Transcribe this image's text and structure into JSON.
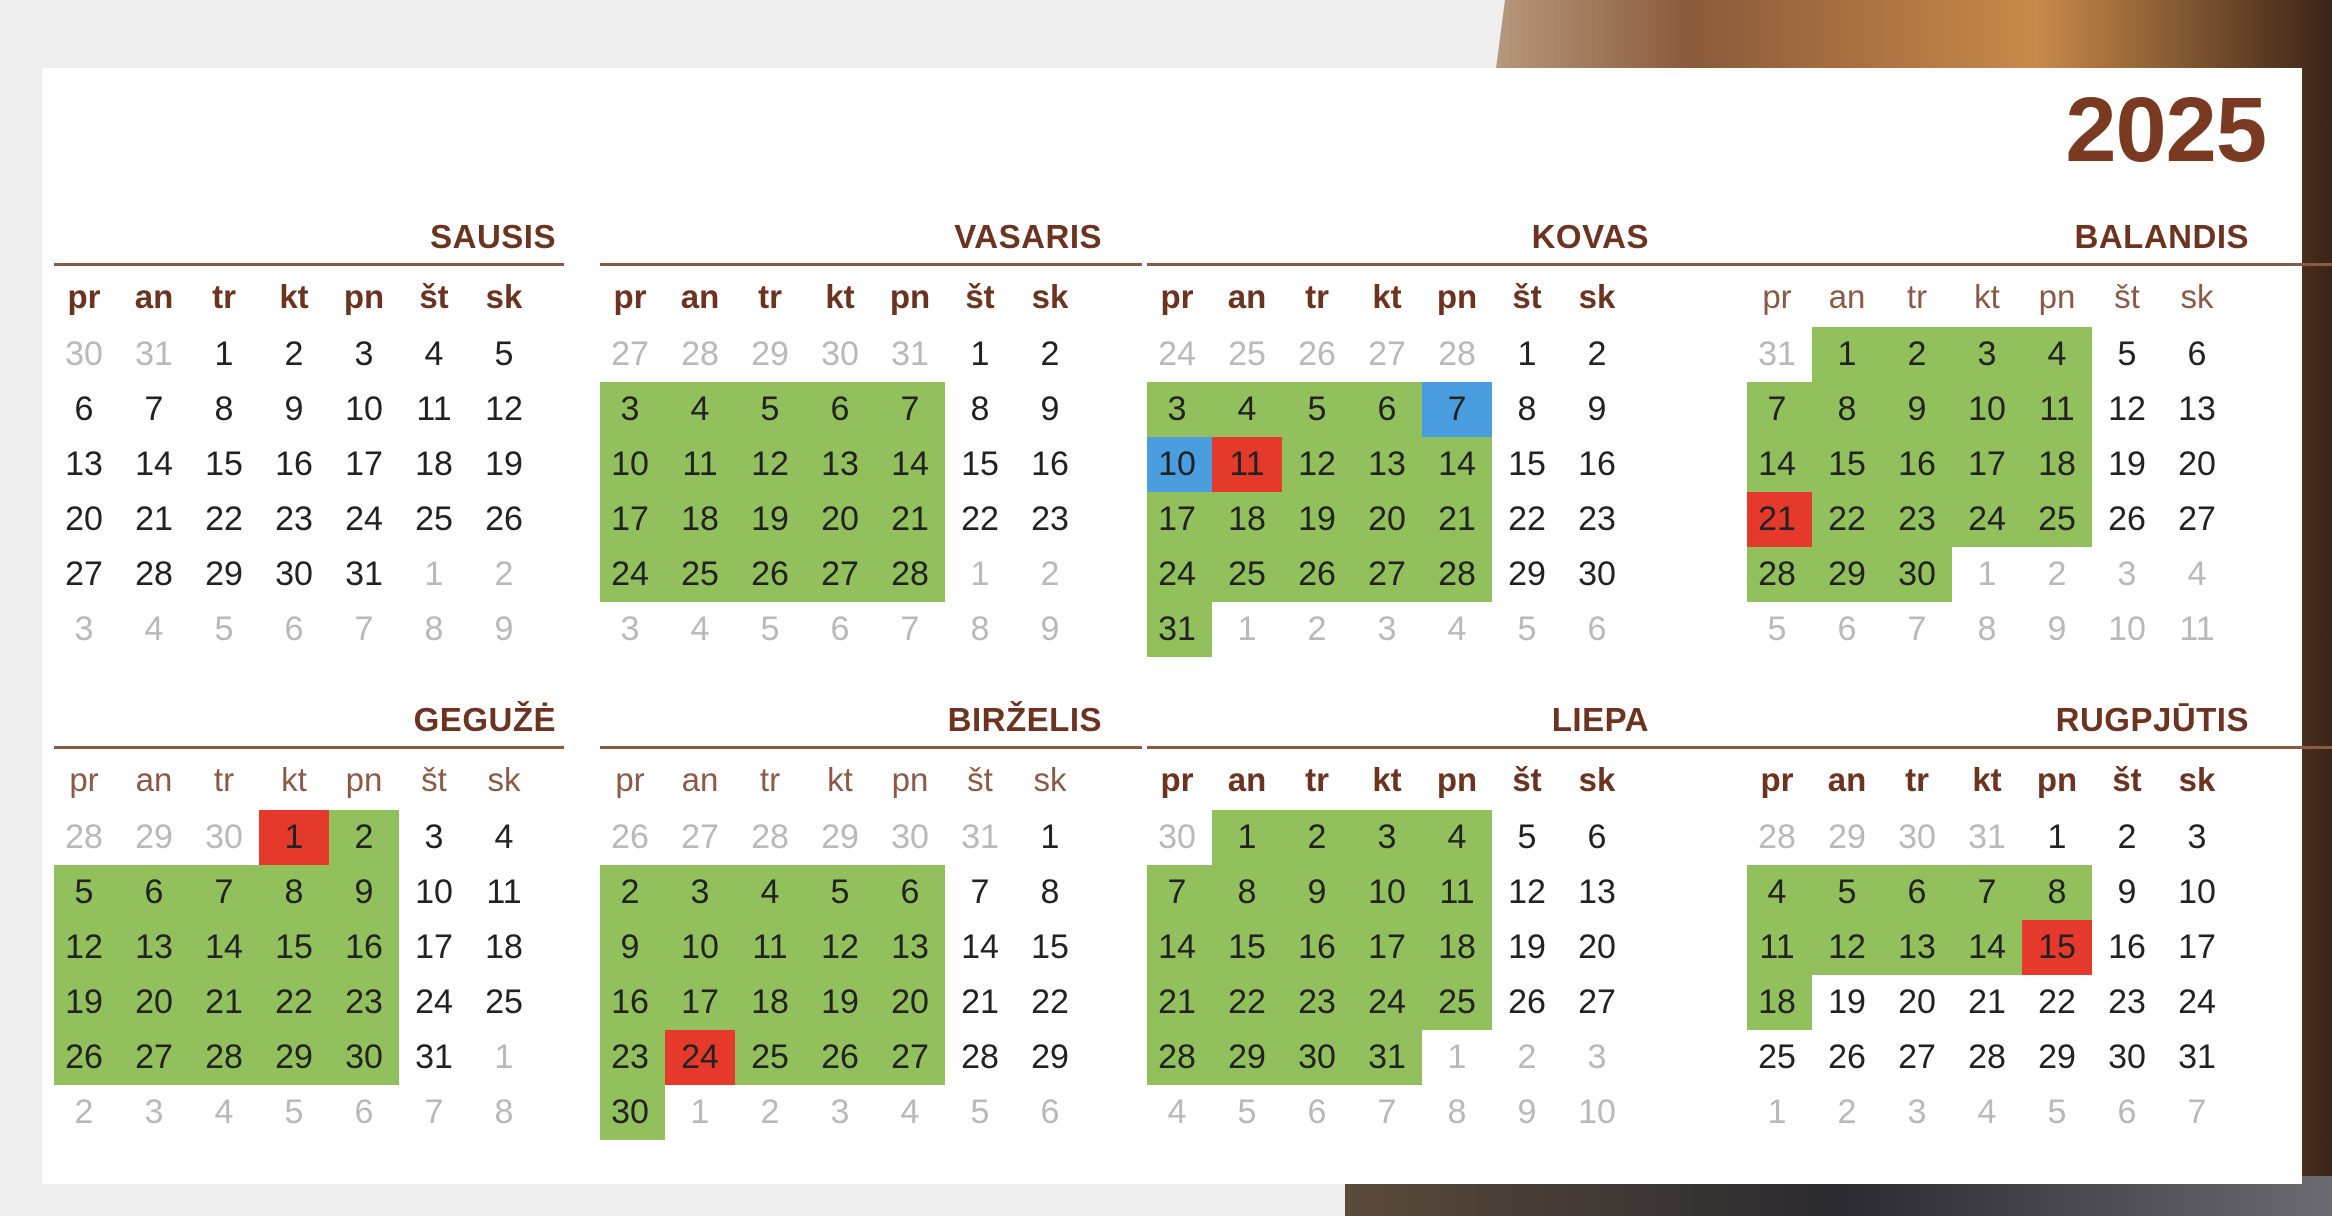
{
  "year": "2025",
  "colors": {
    "workday": "#92c05c",
    "holiday": "#e53a2b",
    "special": "#4a9ee0",
    "title": "#6b3320",
    "muted": "#b9b9b9"
  },
  "day_headers": [
    "pr",
    "an",
    "tr",
    "kt",
    "pn",
    "št",
    "sk"
  ],
  "months": [
    {
      "name": "SAUSIS",
      "bold_headers": true,
      "weeks": [
        [
          30,
          31,
          1,
          2,
          3,
          4,
          5
        ],
        [
          6,
          7,
          8,
          9,
          10,
          11,
          12
        ],
        [
          13,
          14,
          15,
          16,
          17,
          18,
          19
        ],
        [
          20,
          21,
          22,
          23,
          24,
          25,
          26
        ],
        [
          27,
          28,
          29,
          30,
          31,
          1,
          2
        ],
        [
          3,
          4,
          5,
          6,
          7,
          8,
          9
        ]
      ],
      "marks": []
    },
    {
      "name": "VASARIS",
      "bold_headers": true,
      "weeks": [
        [
          27,
          28,
          29,
          30,
          31,
          1,
          2
        ],
        [
          3,
          4,
          5,
          6,
          7,
          8,
          9
        ],
        [
          10,
          11,
          12,
          13,
          14,
          15,
          16
        ],
        [
          17,
          18,
          19,
          20,
          21,
          22,
          23
        ],
        [
          24,
          25,
          26,
          27,
          28,
          1,
          2
        ],
        [
          3,
          4,
          5,
          6,
          7,
          8,
          9
        ]
      ],
      "marks": [
        [
          1,
          -1,
          4,
          "green"
        ],
        [
          2,
          -1,
          4,
          "green"
        ],
        [
          3,
          -1,
          4,
          "green"
        ],
        [
          4,
          -1,
          4,
          "green"
        ]
      ]
    },
    {
      "name": "KOVAS",
      "bold_headers": true,
      "weeks": [
        [
          24,
          25,
          26,
          27,
          28,
          1,
          2
        ],
        [
          3,
          4,
          5,
          6,
          7,
          8,
          9
        ],
        [
          10,
          11,
          12,
          13,
          14,
          15,
          16
        ],
        [
          17,
          18,
          19,
          20,
          21,
          22,
          23
        ],
        [
          24,
          25,
          26,
          27,
          28,
          29,
          30
        ],
        [
          31,
          1,
          2,
          3,
          4,
          5,
          6
        ]
      ],
      "marks": [
        [
          1,
          -1,
          3,
          "green"
        ],
        [
          1,
          4,
          4,
          "blue"
        ],
        [
          2,
          -1,
          0,
          "blue"
        ],
        [
          2,
          1,
          1,
          "red"
        ],
        [
          2,
          2,
          4,
          "green"
        ],
        [
          3,
          -1,
          4,
          "green"
        ],
        [
          4,
          -1,
          4,
          "green"
        ],
        [
          5,
          -1,
          0,
          "green"
        ]
      ]
    },
    {
      "name": "BALANDIS",
      "bold_headers": false,
      "weeks": [
        [
          31,
          1,
          2,
          3,
          4,
          5,
          6
        ],
        [
          7,
          8,
          9,
          10,
          11,
          12,
          13
        ],
        [
          14,
          15,
          16,
          17,
          18,
          19,
          20
        ],
        [
          21,
          22,
          23,
          24,
          25,
          26,
          27
        ],
        [
          28,
          29,
          30,
          1,
          2,
          3,
          4
        ],
        [
          5,
          6,
          7,
          8,
          9,
          10,
          11
        ]
      ],
      "marks": [
        [
          0,
          1,
          4,
          "green"
        ],
        [
          1,
          -1,
          4,
          "green"
        ],
        [
          2,
          -1,
          4,
          "green"
        ],
        [
          3,
          -1,
          0,
          "red"
        ],
        [
          3,
          1,
          4,
          "green"
        ],
        [
          4,
          -1,
          2,
          "green"
        ]
      ]
    },
    {
      "name": "GEGUŽĖ",
      "bold_headers": false,
      "weeks": [
        [
          28,
          29,
          30,
          1,
          2,
          3,
          4
        ],
        [
          5,
          6,
          7,
          8,
          9,
          10,
          11
        ],
        [
          12,
          13,
          14,
          15,
          16,
          17,
          18
        ],
        [
          19,
          20,
          21,
          22,
          23,
          24,
          25
        ],
        [
          26,
          27,
          28,
          29,
          30,
          31,
          1
        ],
        [
          2,
          3,
          4,
          5,
          6,
          7,
          8
        ]
      ],
      "marks": [
        [
          0,
          3,
          3,
          "red"
        ],
        [
          0,
          4,
          4,
          "green"
        ],
        [
          1,
          -1,
          4,
          "green"
        ],
        [
          2,
          -1,
          4,
          "green"
        ],
        [
          3,
          -1,
          4,
          "green"
        ],
        [
          4,
          -1,
          4,
          "green"
        ]
      ]
    },
    {
      "name": "BIRŽELIS",
      "bold_headers": false,
      "weeks": [
        [
          26,
          27,
          28,
          29,
          30,
          31,
          1
        ],
        [
          2,
          3,
          4,
          5,
          6,
          7,
          8
        ],
        [
          9,
          10,
          11,
          12,
          13,
          14,
          15
        ],
        [
          16,
          17,
          18,
          19,
          20,
          21,
          22
        ],
        [
          23,
          24,
          25,
          26,
          27,
          28,
          29
        ],
        [
          30,
          1,
          2,
          3,
          4,
          5,
          6
        ]
      ],
      "marks": [
        [
          1,
          -1,
          4,
          "green"
        ],
        [
          2,
          -1,
          4,
          "green"
        ],
        [
          3,
          -1,
          4,
          "green"
        ],
        [
          4,
          -1,
          0,
          "green"
        ],
        [
          4,
          1,
          1,
          "red"
        ],
        [
          4,
          2,
          4,
          "green"
        ],
        [
          5,
          -1,
          0,
          "green"
        ]
      ]
    },
    {
      "name": "LIEPA",
      "bold_headers": true,
      "weeks": [
        [
          30,
          1,
          2,
          3,
          4,
          5,
          6
        ],
        [
          7,
          8,
          9,
          10,
          11,
          12,
          13
        ],
        [
          14,
          15,
          16,
          17,
          18,
          19,
          20
        ],
        [
          21,
          22,
          23,
          24,
          25,
          26,
          27
        ],
        [
          28,
          29,
          30,
          31,
          1,
          2,
          3
        ],
        [
          4,
          5,
          6,
          7,
          8,
          9,
          10
        ]
      ],
      "marks": [
        [
          0,
          1,
          4,
          "green"
        ],
        [
          1,
          -1,
          4,
          "green"
        ],
        [
          2,
          -1,
          4,
          "green"
        ],
        [
          3,
          -1,
          4,
          "green"
        ],
        [
          4,
          -1,
          3,
          "green"
        ]
      ]
    },
    {
      "name": "RUGPJŪTIS",
      "bold_headers": true,
      "weeks": [
        [
          28,
          29,
          30,
          31,
          1,
          2,
          3
        ],
        [
          4,
          5,
          6,
          7,
          8,
          9,
          10
        ],
        [
          11,
          12,
          13,
          14,
          15,
          16,
          17
        ],
        [
          18,
          19,
          20,
          21,
          22,
          23,
          24
        ],
        [
          25,
          26,
          27,
          28,
          29,
          30,
          31
        ],
        [
          1,
          2,
          3,
          4,
          5,
          6,
          7
        ]
      ],
      "marks": [
        [
          1,
          -1,
          4,
          "green"
        ],
        [
          2,
          -1,
          3,
          "green"
        ],
        [
          2,
          4,
          4,
          "red"
        ],
        [
          3,
          -1,
          0,
          "green"
        ]
      ]
    }
  ]
}
